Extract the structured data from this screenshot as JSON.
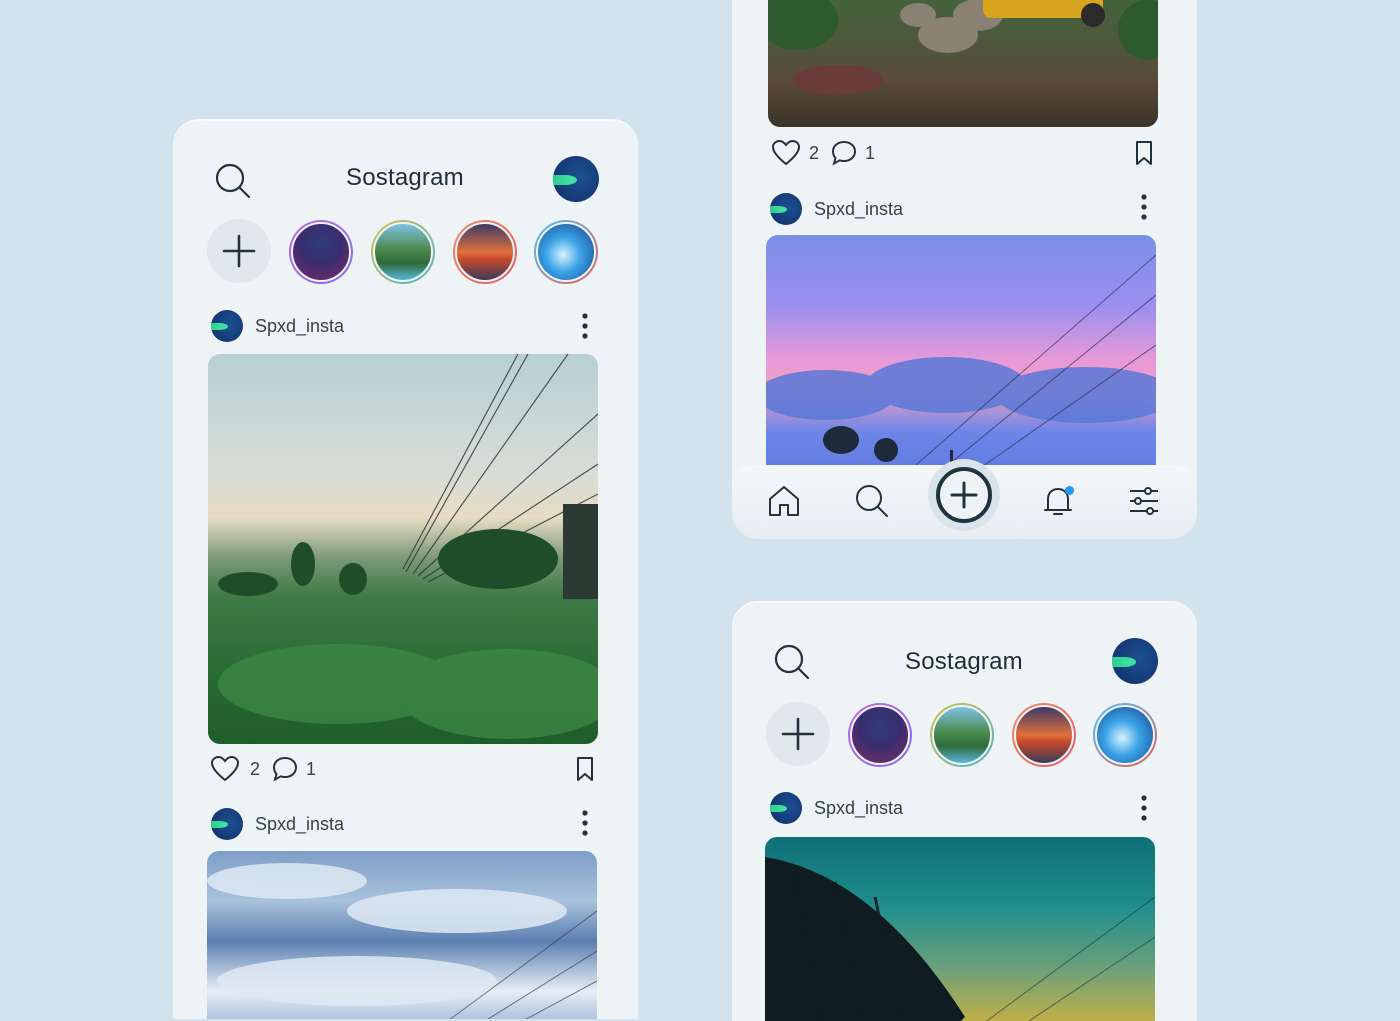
{
  "app": {
    "title": "Sostagram"
  },
  "left_screen": {
    "posts": [
      {
        "username": "Spxd_insta",
        "likes": "2",
        "comments": "1"
      },
      {
        "username": "Spxd_insta"
      }
    ]
  },
  "top_right_screen": {
    "posts": [
      {
        "likes": "2",
        "comments": "1"
      },
      {
        "username": "Spxd_insta"
      }
    ],
    "nav": [
      "home-icon",
      "search-icon",
      "add-icon",
      "bell-icon",
      "sliders-icon"
    ]
  },
  "bottom_right_screen": {
    "posts": [
      {
        "username": "Spxd_insta"
      }
    ]
  },
  "stories": [
    "story-person",
    "story-island",
    "story-sunset",
    "story-wave"
  ],
  "colors": {
    "background": "#d3e3ed",
    "card": "#eef3f6",
    "accent": "#1e9bf0",
    "avatar": "#153c78"
  }
}
